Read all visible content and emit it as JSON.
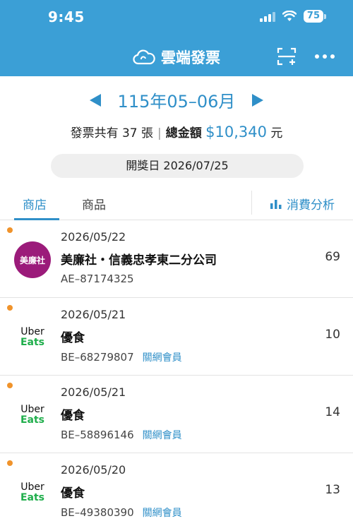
{
  "status": {
    "time": "9:45",
    "battery": "75"
  },
  "header": {
    "title": "雲端發票"
  },
  "period": {
    "label": "115年05–06月"
  },
  "summary": {
    "count_text": "發票共有 37 張",
    "total_label": "總金額",
    "amount": "$10,340",
    "unit": "元"
  },
  "draw_date": "開獎日 2026/07/25",
  "tabs": {
    "store": "商店",
    "product": "商品",
    "analysis": "消費分析"
  },
  "invoices": [
    {
      "date": "2026/05/22",
      "store": "美廉社・信義忠孝東二分公司",
      "number": "AE–87174325",
      "member": "",
      "count": "69",
      "logo_text": "美廉社"
    },
    {
      "date": "2026/05/21",
      "store": "優食",
      "number": "BE–68279807",
      "member": "關網會員",
      "count": "10",
      "logo_text": "Uber Eats"
    },
    {
      "date": "2026/05/21",
      "store": "優食",
      "number": "BE–58896146",
      "member": "關網會員",
      "count": "14",
      "logo_text": "Uber Eats"
    },
    {
      "date": "2026/05/20",
      "store": "優食",
      "number": "BE–49380390",
      "member": "關網會員",
      "count": "13",
      "logo_text": "Uber Eats"
    }
  ],
  "colors": {
    "accent": "#3b9fd6",
    "link": "#2f8fc8",
    "unread_dot": "#f0932b",
    "brand_pxmart": "#9b1b7a",
    "brand_uber_green": "#1fae4b"
  },
  "icons": {
    "cloud": "cloud-icon",
    "scan": "scan-add-icon",
    "more": "more-icon",
    "analysis": "bar-chart-icon"
  }
}
